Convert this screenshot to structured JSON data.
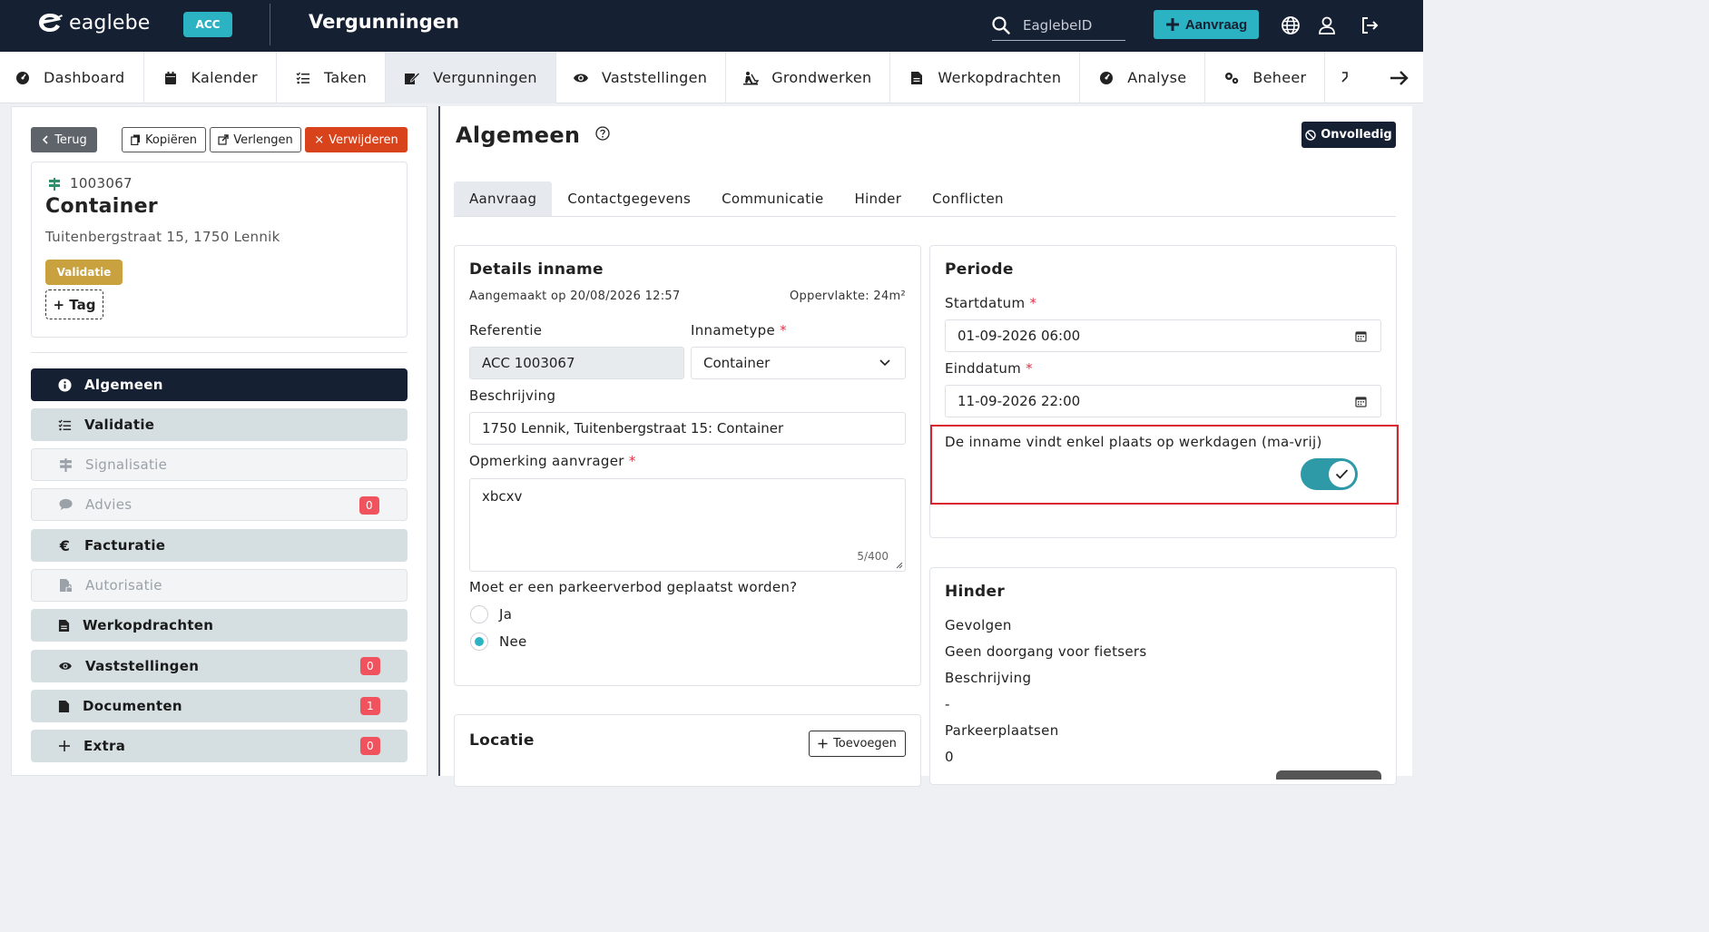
{
  "header": {
    "logo_text": "eaglebe",
    "env_badge": "ACC",
    "app_title": "Vergunningen",
    "search_placeholder": "EaglebeID",
    "new_request_label": "Aanvraag"
  },
  "nav": {
    "items": [
      {
        "label": "Dashboard",
        "icon": "dashboard-icon"
      },
      {
        "label": "Kalender",
        "icon": "calendar-icon"
      },
      {
        "label": "Taken",
        "icon": "task-list-icon"
      },
      {
        "label": "Vergunningen",
        "icon": "permit-icon"
      },
      {
        "label": "Vaststellingen",
        "icon": "eye-icon"
      },
      {
        "label": "Grondwerken",
        "icon": "digging-icon"
      },
      {
        "label": "Werkopdrachten",
        "icon": "document-icon"
      },
      {
        "label": "Analyse",
        "icon": "dashboard-icon"
      },
      {
        "label": "Beheer",
        "icon": "gears-icon"
      }
    ]
  },
  "left": {
    "back_label": "Terug",
    "copy_label": "Kopiëren",
    "extend_label": "Verlengen",
    "delete_label": "Verwijderen",
    "card": {
      "id": "1003067",
      "title": "Container",
      "address": "Tuitenbergstraat 15, 1750 Lennik",
      "status": "Validatie",
      "add_tag_label": "+ Tag"
    },
    "menu": [
      {
        "label": "Algemeen",
        "state": "active",
        "badge": null
      },
      {
        "label": "Validatie",
        "state": "normal",
        "badge": null
      },
      {
        "label": "Signalisatie",
        "state": "disabled",
        "badge": null
      },
      {
        "label": "Advies",
        "state": "disabled",
        "badge": "0"
      },
      {
        "label": "Facturatie",
        "state": "normal",
        "badge": null
      },
      {
        "label": "Autorisatie",
        "state": "disabled",
        "badge": null
      },
      {
        "label": "Werkopdrachten",
        "state": "normal",
        "badge": null
      },
      {
        "label": "Vaststellingen",
        "state": "normal",
        "badge": "0"
      },
      {
        "label": "Documenten",
        "state": "normal",
        "badge": "1"
      },
      {
        "label": "Extra",
        "state": "normal",
        "badge": "0"
      }
    ]
  },
  "main": {
    "title": "Algemeen",
    "incomplete_label": "Onvolledig",
    "tabs": [
      "Aanvraag",
      "Contactgegevens",
      "Communicatie",
      "Hinder",
      "Conflicten"
    ],
    "details": {
      "title": "Details inname",
      "created": "Aangemaakt op 20/08/2026 12:57",
      "area": "Oppervlakte: 24m²",
      "ref_label": "Referentie",
      "ref_value": "ACC 1003067",
      "type_label": "Innametype",
      "type_value": "Container",
      "desc_label": "Beschrijving",
      "desc_value": "1750 Lennik, Tuitenbergstraat 15: Container",
      "remark_label": "Opmerking aanvrager",
      "remark_value": "xbcxv",
      "remark_counter": "5/400",
      "parking_question": "Moet er een parkeerverbod geplaatst worden?",
      "option_yes": "Ja",
      "option_no": "Nee",
      "selected": "Nee"
    },
    "locatie": {
      "title": "Locatie",
      "add_label": "Toevoegen"
    },
    "periode": {
      "title": "Periode",
      "start_label": "Startdatum",
      "start_value": "01-09-2026 06:00",
      "end_label": "Einddatum",
      "end_value": "11-09-2026 22:00",
      "workdays_label": "De inname vindt enkel plaats op werkdagen (ma-vrij)",
      "workdays_on": true
    },
    "hinder": {
      "title": "Hinder",
      "consequences_label": "Gevolgen",
      "consequences_value": "Geen doorgang voor fietsers",
      "desc_label": "Beschrijving",
      "desc_value": "-",
      "parking_label": "Parkeerplaatsen",
      "parking_value": "0"
    }
  },
  "colors": {
    "navy": "#162033",
    "accent": "#2bb3c4",
    "danger": "#d9431c",
    "status_gold": "#c9a23f",
    "highlight_red": "#d9232e"
  }
}
